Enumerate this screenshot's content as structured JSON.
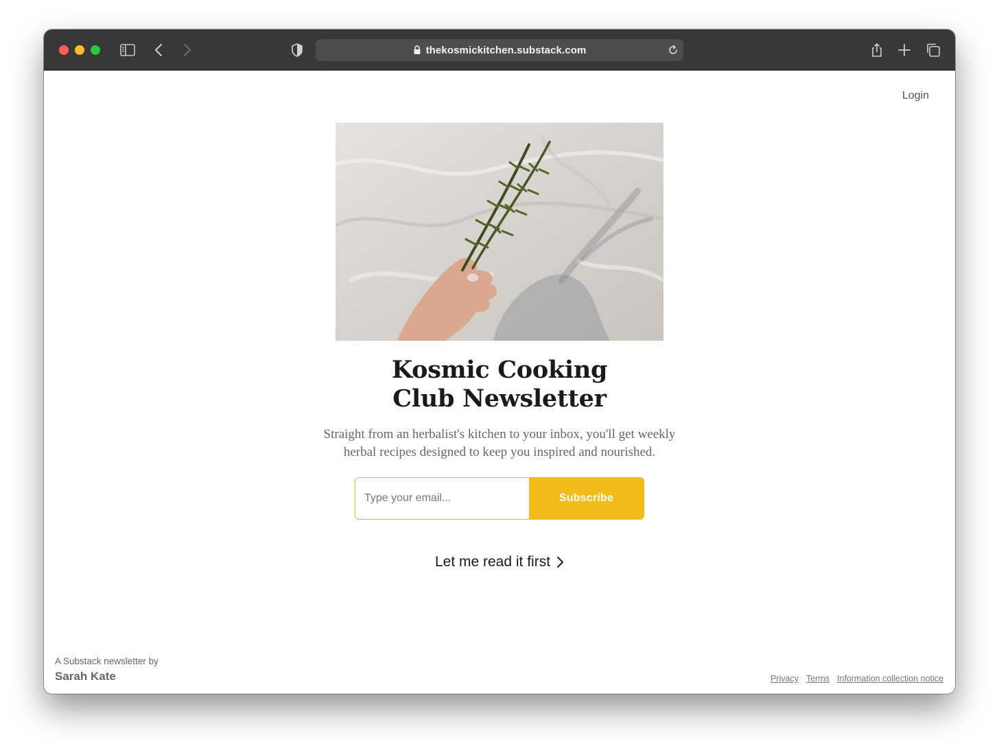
{
  "browser": {
    "url": "thekosmickitchen.substack.com",
    "icons": [
      "sidebar-icon",
      "back-icon",
      "forward-icon",
      "shield-icon",
      "lock-icon",
      "reload-icon",
      "share-icon",
      "new-tab-icon",
      "tabs-overview-icon"
    ]
  },
  "header": {
    "login_label": "Login"
  },
  "hero": {
    "image_description_icon": "rosemary-photo"
  },
  "newsletter": {
    "title_line1": "Kosmic Cooking",
    "title_line2": "Club Newsletter",
    "description_line1": "Straight from an herbalist's kitchen to your inbox, you'll get weekly",
    "description_line2": "herbal recipes designed to keep you inspired and nourished.",
    "email_placeholder": "Type your email...",
    "subscribe_label": "Subscribe",
    "read_first_label": "Let me read it first",
    "accent_color": "#f2bd1b"
  },
  "footer": {
    "byline_prefix": "A Substack newsletter by",
    "author": "Sarah Kate",
    "links": [
      "Privacy",
      "Terms",
      "Information collection notice"
    ]
  }
}
